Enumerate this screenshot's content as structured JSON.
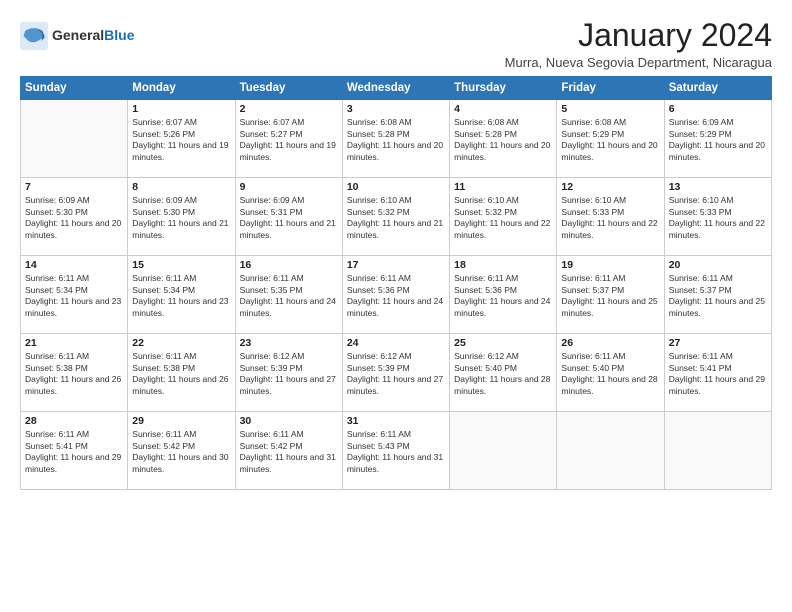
{
  "logo": {
    "general": "General",
    "blue": "Blue"
  },
  "title": "January 2024",
  "location": "Murra, Nueva Segovia Department, Nicaragua",
  "headers": [
    "Sunday",
    "Monday",
    "Tuesday",
    "Wednesday",
    "Thursday",
    "Friday",
    "Saturday"
  ],
  "weeks": [
    [
      {
        "day": "",
        "sunrise": "",
        "sunset": "",
        "daylight": ""
      },
      {
        "day": "1",
        "sunrise": "Sunrise: 6:07 AM",
        "sunset": "Sunset: 5:26 PM",
        "daylight": "Daylight: 11 hours and 19 minutes."
      },
      {
        "day": "2",
        "sunrise": "Sunrise: 6:07 AM",
        "sunset": "Sunset: 5:27 PM",
        "daylight": "Daylight: 11 hours and 19 minutes."
      },
      {
        "day": "3",
        "sunrise": "Sunrise: 6:08 AM",
        "sunset": "Sunset: 5:28 PM",
        "daylight": "Daylight: 11 hours and 20 minutes."
      },
      {
        "day": "4",
        "sunrise": "Sunrise: 6:08 AM",
        "sunset": "Sunset: 5:28 PM",
        "daylight": "Daylight: 11 hours and 20 minutes."
      },
      {
        "day": "5",
        "sunrise": "Sunrise: 6:08 AM",
        "sunset": "Sunset: 5:29 PM",
        "daylight": "Daylight: 11 hours and 20 minutes."
      },
      {
        "day": "6",
        "sunrise": "Sunrise: 6:09 AM",
        "sunset": "Sunset: 5:29 PM",
        "daylight": "Daylight: 11 hours and 20 minutes."
      }
    ],
    [
      {
        "day": "7",
        "sunrise": "Sunrise: 6:09 AM",
        "sunset": "Sunset: 5:30 PM",
        "daylight": "Daylight: 11 hours and 20 minutes."
      },
      {
        "day": "8",
        "sunrise": "Sunrise: 6:09 AM",
        "sunset": "Sunset: 5:30 PM",
        "daylight": "Daylight: 11 hours and 21 minutes."
      },
      {
        "day": "9",
        "sunrise": "Sunrise: 6:09 AM",
        "sunset": "Sunset: 5:31 PM",
        "daylight": "Daylight: 11 hours and 21 minutes."
      },
      {
        "day": "10",
        "sunrise": "Sunrise: 6:10 AM",
        "sunset": "Sunset: 5:32 PM",
        "daylight": "Daylight: 11 hours and 21 minutes."
      },
      {
        "day": "11",
        "sunrise": "Sunrise: 6:10 AM",
        "sunset": "Sunset: 5:32 PM",
        "daylight": "Daylight: 11 hours and 22 minutes."
      },
      {
        "day": "12",
        "sunrise": "Sunrise: 6:10 AM",
        "sunset": "Sunset: 5:33 PM",
        "daylight": "Daylight: 11 hours and 22 minutes."
      },
      {
        "day": "13",
        "sunrise": "Sunrise: 6:10 AM",
        "sunset": "Sunset: 5:33 PM",
        "daylight": "Daylight: 11 hours and 22 minutes."
      }
    ],
    [
      {
        "day": "14",
        "sunrise": "Sunrise: 6:11 AM",
        "sunset": "Sunset: 5:34 PM",
        "daylight": "Daylight: 11 hours and 23 minutes."
      },
      {
        "day": "15",
        "sunrise": "Sunrise: 6:11 AM",
        "sunset": "Sunset: 5:34 PM",
        "daylight": "Daylight: 11 hours and 23 minutes."
      },
      {
        "day": "16",
        "sunrise": "Sunrise: 6:11 AM",
        "sunset": "Sunset: 5:35 PM",
        "daylight": "Daylight: 11 hours and 24 minutes."
      },
      {
        "day": "17",
        "sunrise": "Sunrise: 6:11 AM",
        "sunset": "Sunset: 5:36 PM",
        "daylight": "Daylight: 11 hours and 24 minutes."
      },
      {
        "day": "18",
        "sunrise": "Sunrise: 6:11 AM",
        "sunset": "Sunset: 5:36 PM",
        "daylight": "Daylight: 11 hours and 24 minutes."
      },
      {
        "day": "19",
        "sunrise": "Sunrise: 6:11 AM",
        "sunset": "Sunset: 5:37 PM",
        "daylight": "Daylight: 11 hours and 25 minutes."
      },
      {
        "day": "20",
        "sunrise": "Sunrise: 6:11 AM",
        "sunset": "Sunset: 5:37 PM",
        "daylight": "Daylight: 11 hours and 25 minutes."
      }
    ],
    [
      {
        "day": "21",
        "sunrise": "Sunrise: 6:11 AM",
        "sunset": "Sunset: 5:38 PM",
        "daylight": "Daylight: 11 hours and 26 minutes."
      },
      {
        "day": "22",
        "sunrise": "Sunrise: 6:11 AM",
        "sunset": "Sunset: 5:38 PM",
        "daylight": "Daylight: 11 hours and 26 minutes."
      },
      {
        "day": "23",
        "sunrise": "Sunrise: 6:12 AM",
        "sunset": "Sunset: 5:39 PM",
        "daylight": "Daylight: 11 hours and 27 minutes."
      },
      {
        "day": "24",
        "sunrise": "Sunrise: 6:12 AM",
        "sunset": "Sunset: 5:39 PM",
        "daylight": "Daylight: 11 hours and 27 minutes."
      },
      {
        "day": "25",
        "sunrise": "Sunrise: 6:12 AM",
        "sunset": "Sunset: 5:40 PM",
        "daylight": "Daylight: 11 hours and 28 minutes."
      },
      {
        "day": "26",
        "sunrise": "Sunrise: 6:11 AM",
        "sunset": "Sunset: 5:40 PM",
        "daylight": "Daylight: 11 hours and 28 minutes."
      },
      {
        "day": "27",
        "sunrise": "Sunrise: 6:11 AM",
        "sunset": "Sunset: 5:41 PM",
        "daylight": "Daylight: 11 hours and 29 minutes."
      }
    ],
    [
      {
        "day": "28",
        "sunrise": "Sunrise: 6:11 AM",
        "sunset": "Sunset: 5:41 PM",
        "daylight": "Daylight: 11 hours and 29 minutes."
      },
      {
        "day": "29",
        "sunrise": "Sunrise: 6:11 AM",
        "sunset": "Sunset: 5:42 PM",
        "daylight": "Daylight: 11 hours and 30 minutes."
      },
      {
        "day": "30",
        "sunrise": "Sunrise: 6:11 AM",
        "sunset": "Sunset: 5:42 PM",
        "daylight": "Daylight: 11 hours and 31 minutes."
      },
      {
        "day": "31",
        "sunrise": "Sunrise: 6:11 AM",
        "sunset": "Sunset: 5:43 PM",
        "daylight": "Daylight: 11 hours and 31 minutes."
      },
      {
        "day": "",
        "sunrise": "",
        "sunset": "",
        "daylight": ""
      },
      {
        "day": "",
        "sunrise": "",
        "sunset": "",
        "daylight": ""
      },
      {
        "day": "",
        "sunrise": "",
        "sunset": "",
        "daylight": ""
      }
    ]
  ]
}
